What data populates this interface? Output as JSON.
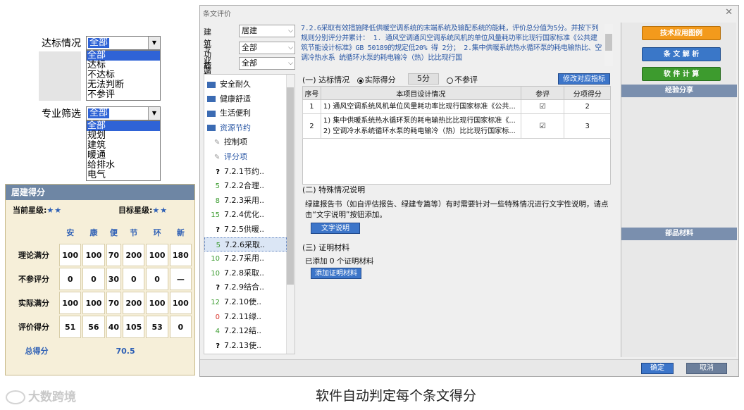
{
  "zoom_reach": {
    "label": "达标情况",
    "selected": "全部",
    "options": [
      "全部",
      "达标",
      "不达标",
      "无法判断",
      "不参评"
    ]
  },
  "zoom_prof": {
    "label": "专业筛选",
    "selected": "全部",
    "options": [
      "全部",
      "规划",
      "建筑",
      "暖通",
      "给排水",
      "电气"
    ]
  },
  "score_panel": {
    "title": "居建得分",
    "current_label": "当前星级:",
    "current_stars": "★★",
    "target_label": "目标星级:",
    "target_stars": "★★",
    "columns": [
      "安",
      "康",
      "便",
      "节",
      "环",
      "新"
    ],
    "rows": [
      {
        "label": "理论满分",
        "values": [
          "100",
          "100",
          "70",
          "200",
          "100",
          "180"
        ]
      },
      {
        "label": "不参评分",
        "values": [
          "0",
          "0",
          "30",
          "0",
          "0",
          "—"
        ]
      },
      {
        "label": "实际满分",
        "values": [
          "100",
          "100",
          "70",
          "200",
          "100",
          "100"
        ]
      },
      {
        "label": "评价得分",
        "values": [
          "51",
          "56",
          "40",
          "105",
          "53",
          "0"
        ]
      }
    ],
    "total_label": "总得分",
    "total_value": "70.5"
  },
  "dialog": {
    "title": "条文评价",
    "filters": [
      {
        "label": "建筑功能",
        "value": "居建"
      },
      {
        "label": "专业筛选",
        "value": "全部"
      },
      {
        "label": "达标情况",
        "value": "全部"
      }
    ],
    "tree": [
      {
        "type": "folder",
        "label": "安全耐久"
      },
      {
        "type": "folder",
        "label": "健康舒适"
      },
      {
        "type": "folder",
        "label": "生活便利"
      },
      {
        "type": "folder-open",
        "label": "资源节约"
      },
      {
        "type": "sub",
        "label": "控制项"
      },
      {
        "type": "sub",
        "label": "评分项"
      },
      {
        "type": "clause",
        "score": "?",
        "color": "#000000",
        "label": "7.2.1节约.."
      },
      {
        "type": "clause",
        "score": "5",
        "color": "#3a9b2e",
        "label": "7.2.2合理.."
      },
      {
        "type": "clause",
        "score": "8",
        "color": "#3a9b2e",
        "label": "7.2.3采用.."
      },
      {
        "type": "clause",
        "score": "15",
        "color": "#3a9b2e",
        "label": "7.2.4优化.."
      },
      {
        "type": "clause",
        "score": "?",
        "color": "#000000",
        "label": "7.2.5供暖.."
      },
      {
        "type": "clause",
        "score": "5",
        "color": "#3a9b2e",
        "label": "7.2.6采取..",
        "selected": true
      },
      {
        "type": "clause",
        "score": "10",
        "color": "#3a9b2e",
        "label": "7.2.7采用.."
      },
      {
        "type": "clause",
        "score": "10",
        "color": "#3a9b2e",
        "label": "7.2.8采取.."
      },
      {
        "type": "clause",
        "score": "?",
        "color": "#000000",
        "label": "7.2.9结合.."
      },
      {
        "type": "clause",
        "score": "12",
        "color": "#3a9b2e",
        "label": "7.2.10使.."
      },
      {
        "type": "clause",
        "score": "0",
        "color": "#d9342b",
        "label": "7.2.11绿.."
      },
      {
        "type": "clause",
        "score": "4",
        "color": "#3a9b2e",
        "label": "7.2.12结.."
      },
      {
        "type": "clause",
        "score": "?",
        "color": "#000000",
        "label": "7.2.13使.."
      }
    ],
    "description": "7.2.6采取有效措施降低供暖空调系统的末端系统及输配系统的能耗，评价总分值为5分。并按下列规则分别评分并累计： 1. 通风空调通风空调系统风机的单位风量耗功率比现行国家标准《公共建筑节能设计标准》GB 50189的规定低20% 得 2分； 2.集中供暖系统热水循环泵的耗电输热比、空调冷热水系 统循环水泵的耗电输冷（热）比比现行国",
    "section1": {
      "title": "(一) 达标情况",
      "radio_actual": "实际得分",
      "score_value": "5分",
      "radio_na": "不参评",
      "modify_button": "修改对应指标"
    },
    "table": {
      "headers": [
        "序号",
        "本项目设计情况",
        "参评",
        "分项得分"
      ],
      "rows": [
        {
          "no": "1",
          "lines": [
            "1) 通风空调系统风机单位风量耗功率比现行国家标准《公共..."
          ],
          "checked": "☑",
          "score": "2"
        },
        {
          "no": "2",
          "lines": [
            "1) 集中供暖系统热水循环泵的耗电输热比比现行国家标准《...",
            "2) 空调冷水系统循环水泵的耗电输冷（热）比比现行国家标..."
          ],
          "checked": "☑",
          "score": "3"
        }
      ]
    },
    "section2": {
      "title": "(二) 特殊情况说明",
      "text": "绿建报告书（如自评估报告、绿建专篇等）有时需要针对一些特殊情况进行文字性说明，请点击“文字说明”按钮添加。",
      "button": "文字说明"
    },
    "section3": {
      "title": "(三) 证明材料",
      "text": "已添加 0 个证明材料",
      "button": "添加证明材料"
    },
    "right": {
      "btn_tech": "技术应用图例",
      "btn_clause": "条 文 解 析",
      "btn_calc": "软 件 计 算",
      "head_exp": "经验分享",
      "head_parts": "部品材料"
    },
    "ok": "确定",
    "cancel": "取消"
  },
  "caption": "软件自动判定每个条文得分",
  "watermark": "大数跨境"
}
